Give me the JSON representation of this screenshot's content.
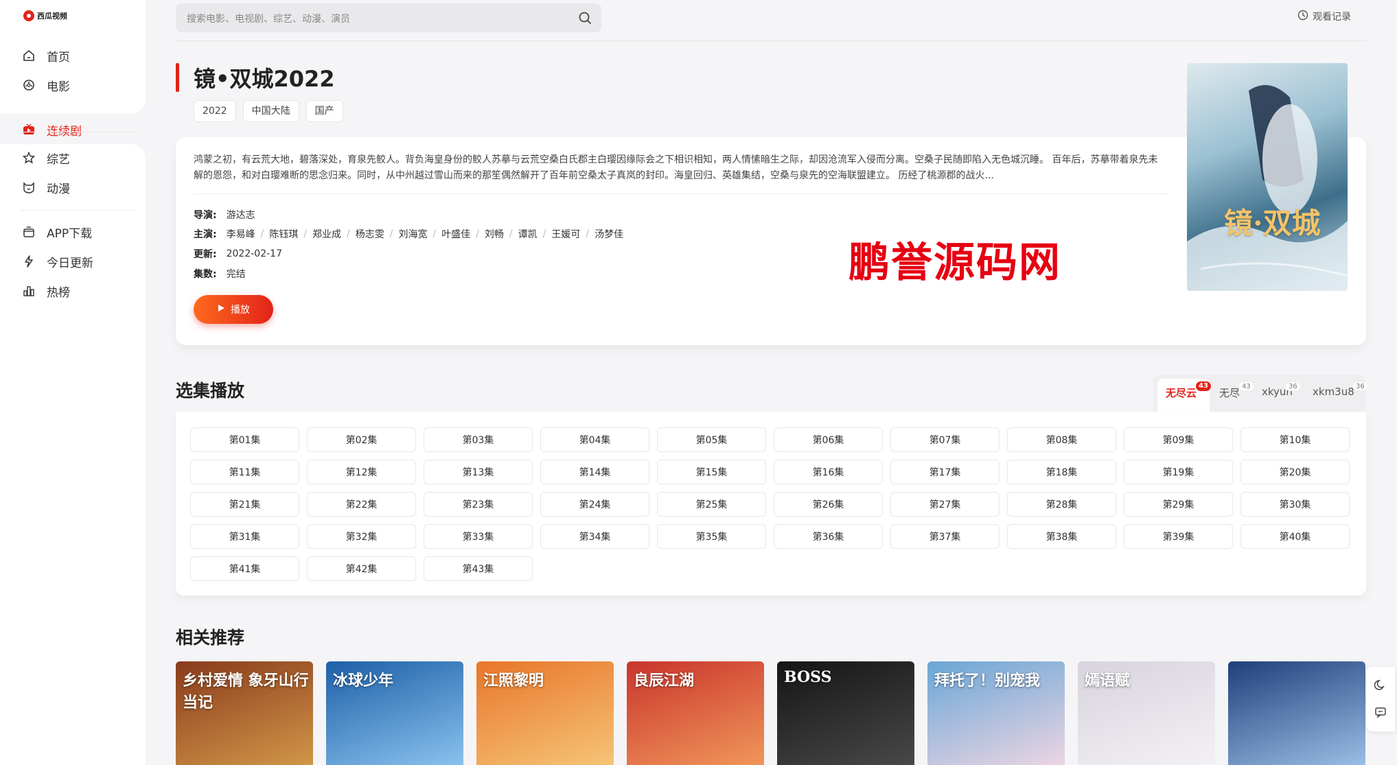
{
  "app": {
    "logo_text": "西瓜视频"
  },
  "sidebar": {
    "items": [
      {
        "label": "首页",
        "icon": "home-icon"
      },
      {
        "label": "电影",
        "icon": "film-icon"
      },
      {
        "label": "连续剧",
        "icon": "tv-icon",
        "active": true
      },
      {
        "label": "综艺",
        "icon": "star-icon"
      },
      {
        "label": "动漫",
        "icon": "anime-icon"
      },
      {
        "label": "APP下载",
        "icon": "app-icon"
      },
      {
        "label": "今日更新",
        "icon": "flash-icon"
      },
      {
        "label": "热榜",
        "icon": "chart-icon"
      }
    ]
  },
  "header": {
    "search_placeholder": "搜索电影、电视剧、综艺、动漫、演员",
    "history_label": "观看记录"
  },
  "detail": {
    "title": "镜•双城2022",
    "tags": [
      "2022",
      "中国大陆",
      "国产"
    ],
    "description": "鸿蒙之初，有云荒大地，碧落深处，育泉先鲛人。背负海皇身份的鲛人苏摹与云荒空桑白氏郡主白璎因缘际会之下相识相知，两人情愫暗生之际，却因沧流军入侵而分离。空桑子民随即陷入无色城沉睡。 百年后，苏摹带着泉先未解的恩怨，和对白璎难断的思念归来。同时，从中州越过雪山而来的那笙偶然解开了百年前空桑太子真岚的封印。海皇回归、英雄集结，空桑与泉先的空海联盟建立。 历经了桃源郡的战火...",
    "director_label": "导演:",
    "director": "游达志",
    "cast_label": "主演:",
    "cast": [
      "李易峰",
      "陈钰琪",
      "郑业成",
      "杨志雯",
      "刘海宽",
      "叶盛佳",
      "刘畅",
      "谭凯",
      "王媛可",
      "汤梦佳"
    ],
    "updated_label": "更新:",
    "updated": "2022-02-17",
    "episodes_label": "集数:",
    "episodes_status": "完结",
    "play_label": "播放",
    "watermark": "鹏誉源码网",
    "poster_title": "镜·双城"
  },
  "episodes": {
    "section_title": "选集播放",
    "sources": [
      {
        "label": "无尽云",
        "count": "43",
        "active": true
      },
      {
        "label": "无尽",
        "count": "43"
      },
      {
        "label": "xkyun",
        "count": "36"
      },
      {
        "label": "xkm3u8",
        "count": "36"
      }
    ],
    "list": [
      "第01集",
      "第02集",
      "第03集",
      "第04集",
      "第05集",
      "第06集",
      "第07集",
      "第08集",
      "第09集",
      "第10集",
      "第11集",
      "第12集",
      "第13集",
      "第14集",
      "第15集",
      "第16集",
      "第17集",
      "第18集",
      "第19集",
      "第20集",
      "第21集",
      "第22集",
      "第23集",
      "第24集",
      "第25集",
      "第26集",
      "第27集",
      "第28集",
      "第29集",
      "第30集",
      "第31集",
      "第32集",
      "第33集",
      "第34集",
      "第35集",
      "第36集",
      "第37集",
      "第38集",
      "第39集",
      "第40集",
      "第41集",
      "第42集",
      "第43集"
    ]
  },
  "related": {
    "section_title": "相关推荐",
    "items": [
      {
        "caption": "乡村爱情 象牙山行当记",
        "colors": [
          "#8a3b1c",
          "#d49a4a"
        ]
      },
      {
        "caption": "冰球少年",
        "colors": [
          "#1d5fa8",
          "#8fc6f0"
        ]
      },
      {
        "caption": "江照黎明",
        "colors": [
          "#e8762a",
          "#f6c77a"
        ]
      },
      {
        "caption": "良辰江湖",
        "colors": [
          "#c9352c",
          "#f29a5c"
        ]
      },
      {
        "caption": "BOSS",
        "colors": [
          "#151515",
          "#4a4a4a"
        ]
      },
      {
        "caption": "拜托了！别宠我",
        "colors": [
          "#6aa6d6",
          "#f1d7e3"
        ]
      },
      {
        "caption": "嫣语赋",
        "colors": [
          "#d8d3dd",
          "#f4f2f6"
        ]
      },
      {
        "caption": "",
        "colors": [
          "#1f3f7a",
          "#9fc3ea"
        ]
      }
    ]
  }
}
